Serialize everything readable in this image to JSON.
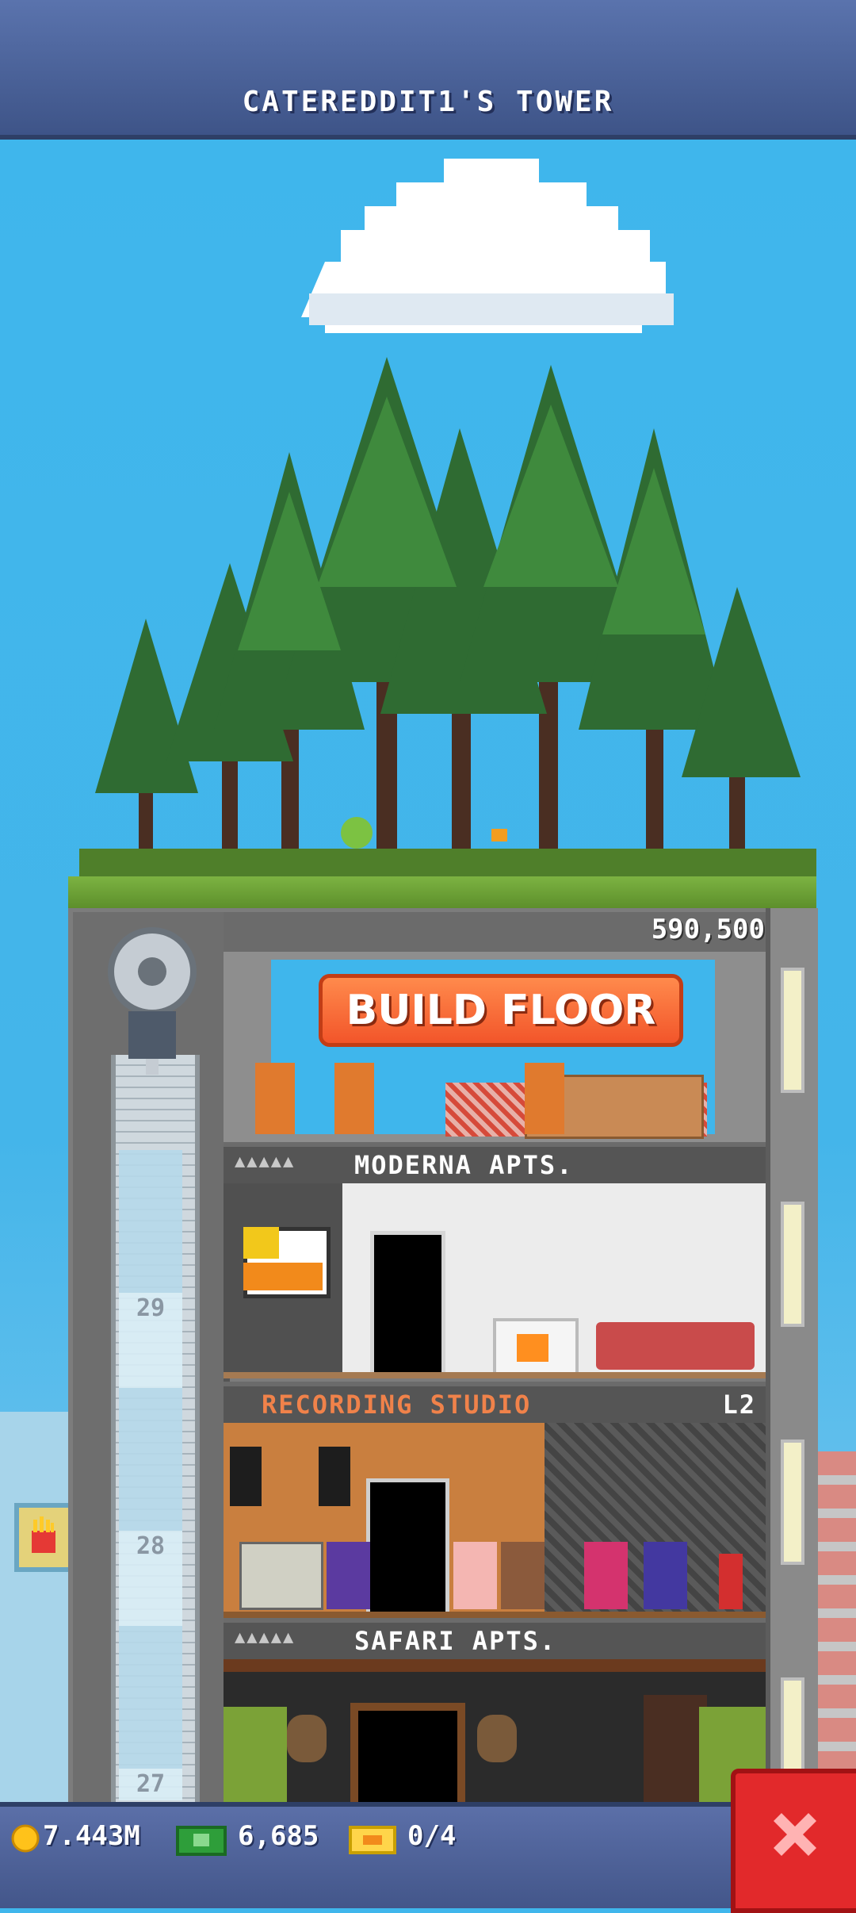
{
  "header": {
    "title": "CATEREDDIT1'S TOWER"
  },
  "build": {
    "price": "590,500",
    "button_label": "BUILD FLOOR"
  },
  "floors": [
    {
      "name": "MODERNA APTS.",
      "level": "",
      "residents_dots": "▲▲▲▲▲",
      "elevator_number": "29"
    },
    {
      "name": "RECORDING STUDIO",
      "level": "L2",
      "residents_dots": "",
      "elevator_number": "28"
    },
    {
      "name": "SAFARI APTS.",
      "level": "",
      "residents_dots": "▲▲▲▲▲",
      "elevator_number": "27"
    }
  ],
  "status": {
    "coins": "7.443M",
    "bux": "6,685",
    "tickets": "0/4"
  },
  "colors": {
    "accent_orange": "#f2552a",
    "close_red": "#e2292b",
    "bar_blue": "#4b5f96"
  },
  "icons": {
    "coin": "coin-icon",
    "bux": "bux-icon",
    "ticket": "ticket-icon",
    "close": "close-icon"
  }
}
